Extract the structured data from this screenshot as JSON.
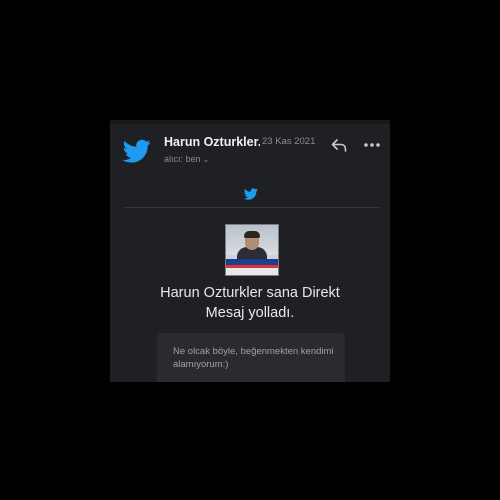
{
  "email": {
    "sender": "Harun Ozturkler...",
    "date": "23 Kas 2021",
    "recipient": "alıcı: ben",
    "recipient_chevron": "⌄",
    "headline_line1": "Harun Ozturkler sana Direkt",
    "headline_line2": "Mesaj yolladı.",
    "message": "Ne olcak böyle, beğenmekten kendimi alamıyorum:)"
  },
  "icons": {
    "sender_logo": "twitter-bird-icon",
    "reply": "reply-arrow-icon",
    "more": "more-dots-icon",
    "mid_logo": "twitter-bird-icon",
    "avatar": "profile-photo"
  },
  "colors": {
    "background": "#000000",
    "panel": "#1f2023",
    "twitter_blue": "#1d9bf0",
    "text_primary": "#e8e8e8",
    "text_secondary": "#8a8c90",
    "bubble": "#2a2b2e"
  }
}
